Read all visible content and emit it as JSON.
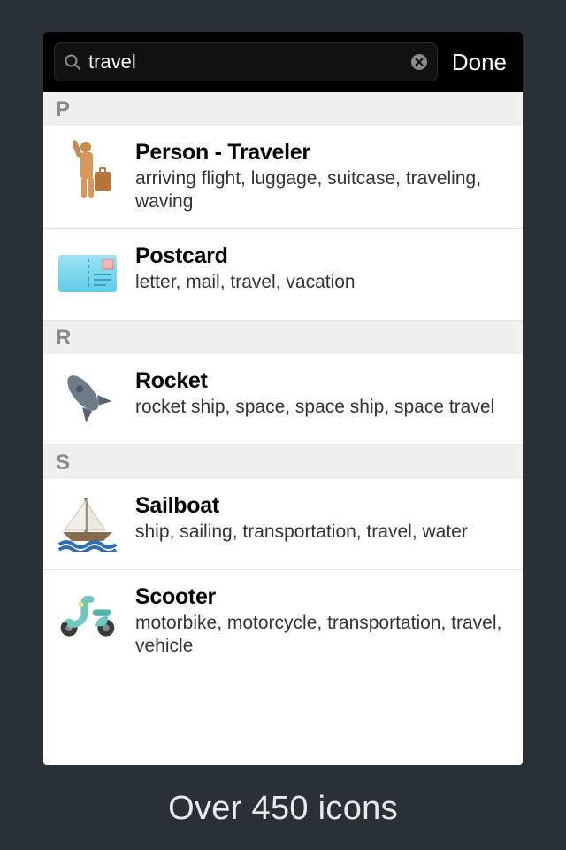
{
  "search": {
    "value": "travel",
    "done_label": "Done"
  },
  "sections": [
    {
      "letter": "P",
      "items": [
        {
          "icon": "person-traveler",
          "title": "Person - Traveler",
          "tags": "arriving flight, luggage, suitcase, traveling, waving"
        },
        {
          "icon": "postcard",
          "title": "Postcard",
          "tags": "letter, mail, travel, vacation"
        }
      ]
    },
    {
      "letter": "R",
      "items": [
        {
          "icon": "rocket",
          "title": "Rocket",
          "tags": "rocket ship, space, space ship, space travel"
        }
      ]
    },
    {
      "letter": "S",
      "items": [
        {
          "icon": "sailboat",
          "title": "Sailboat",
          "tags": "ship, sailing, transportation, travel, water"
        },
        {
          "icon": "scooter",
          "title": "Scooter",
          "tags": "motorbike, motorcycle, transportation, travel, vehicle"
        }
      ]
    }
  ],
  "footer": "Over 450 icons"
}
